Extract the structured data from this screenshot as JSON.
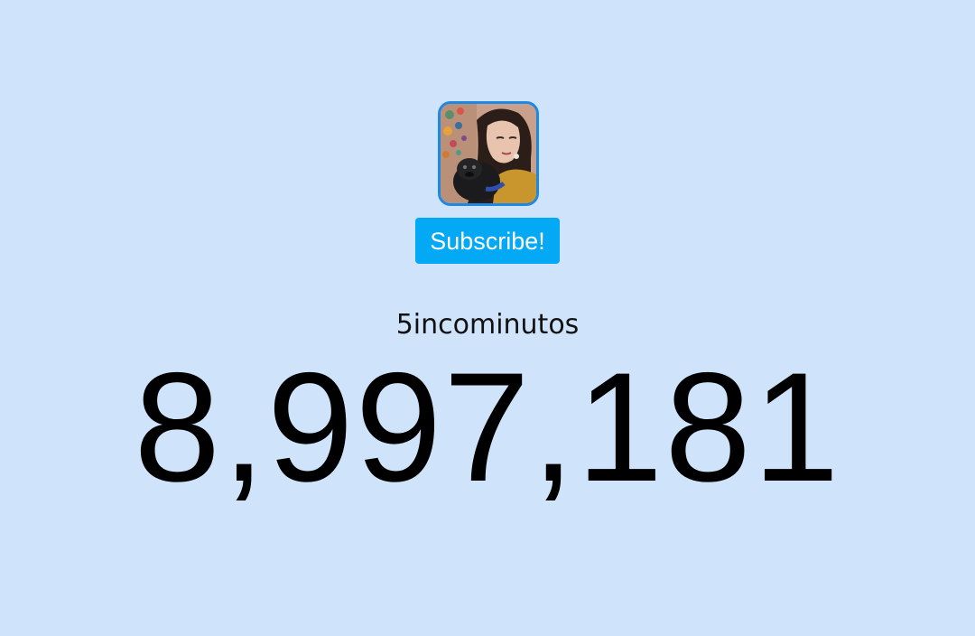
{
  "profile": {
    "avatar_icon": "channel-avatar-photo",
    "avatar_border_color": "#1e88e5"
  },
  "subscribe": {
    "label": "Subscribe!",
    "color": "#03a9f4"
  },
  "channel": {
    "name": "5incominutos"
  },
  "subscribers": {
    "count": "8,997,181"
  },
  "theme": {
    "background": "#cfe3fb"
  }
}
